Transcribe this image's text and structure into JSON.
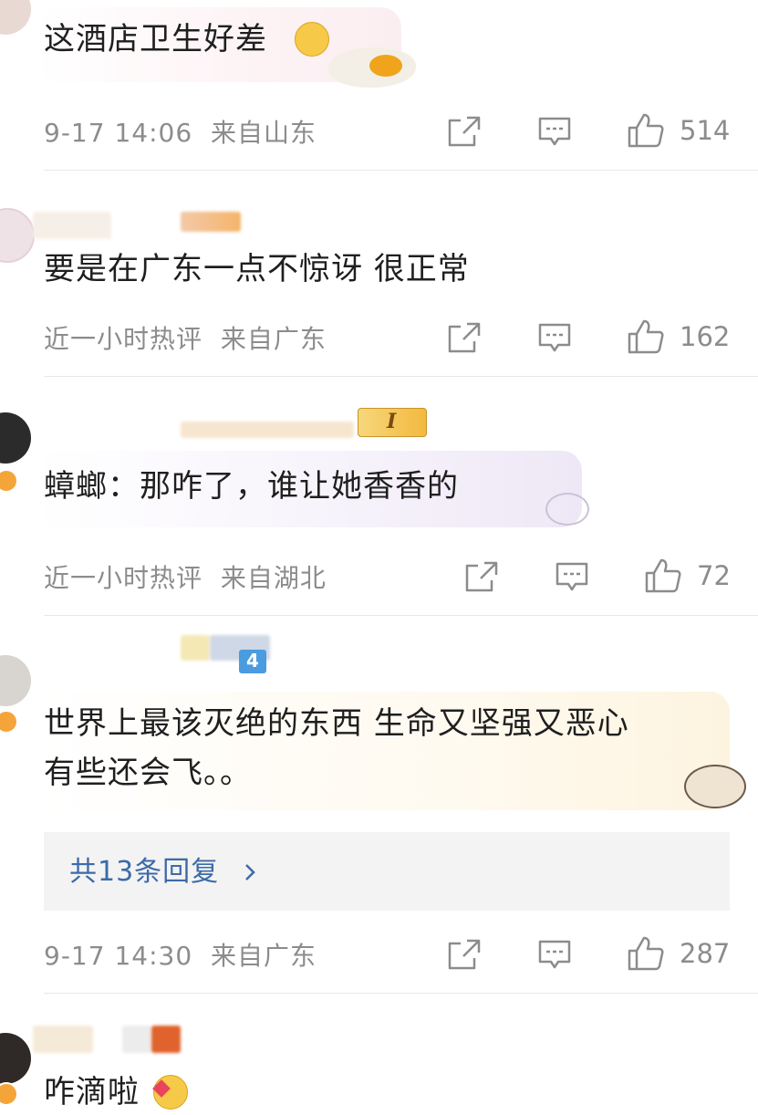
{
  "comments": [
    {
      "text": "这酒店卫生好差",
      "time": "9-17 14:06",
      "location": "来自山东",
      "likes": "514",
      "emoji": "crying-face-emoji"
    },
    {
      "text": "要是在广东一点不惊讶 很正常",
      "time": "近一小时热评",
      "location": "来自广东",
      "likes": "162"
    },
    {
      "text": "蟑螂：那咋了，谁让她香香的",
      "time": "近一小时热评",
      "location": "来自湖北",
      "likes": "72",
      "badge": "I"
    },
    {
      "text_line1": "世界上最该灭绝的东西 生命又坚强又恶心",
      "text_line2": "有些还会飞。。",
      "time": "9-17 14:30",
      "location": "来自广东",
      "likes": "287",
      "replies": "共13条回复",
      "level": "4"
    },
    {
      "text": "咋滴啦",
      "emoji": "heart-face-emoji"
    }
  ],
  "icons": {
    "share": "share-icon",
    "comment": "comment-icon",
    "like": "thumbs-up-icon",
    "chevron": "chevron-right-icon"
  },
  "colors": {
    "link": "#3d6aa8",
    "meta": "#8c8c8c",
    "verified": "#f4a53a"
  }
}
